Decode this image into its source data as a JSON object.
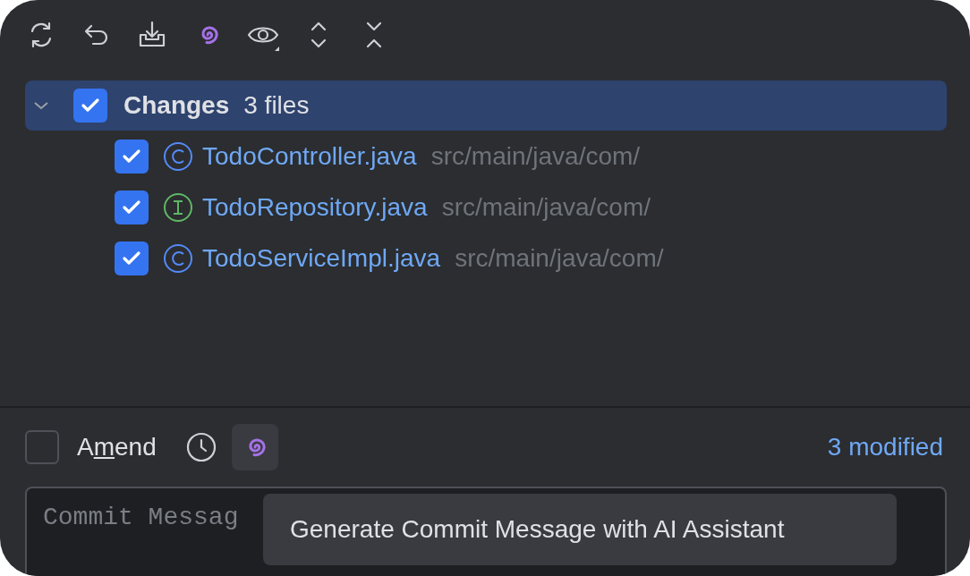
{
  "toolbar": [
    {
      "kind": "refresh"
    },
    {
      "kind": "rollback"
    },
    {
      "kind": "shelve"
    },
    {
      "kind": "ai"
    },
    {
      "kind": "view"
    },
    {
      "kind": "expand"
    },
    {
      "kind": "collapse"
    }
  ],
  "changes": {
    "title": "Changes",
    "count": "3 files",
    "expanded": true,
    "checked": true,
    "selected": true,
    "files": [
      {
        "name": "TodoController.java",
        "kind": "class",
        "path": "src/main/java/com/",
        "checked": true
      },
      {
        "name": "TodoRepository.java",
        "kind": "interface",
        "path": "src/main/java/com/",
        "checked": true
      },
      {
        "name": "TodoServiceImpl.java",
        "kind": "class",
        "path": "src/main/java/com/",
        "checked": true
      }
    ]
  },
  "amend": {
    "label_start": "A",
    "mnemonic": "m",
    "label_end": "end",
    "checked": false
  },
  "summary": "3 modified",
  "commit_message": {
    "placeholder": "Commit Messag"
  },
  "tooltip": "Generate Commit Message with AI Assistant"
}
